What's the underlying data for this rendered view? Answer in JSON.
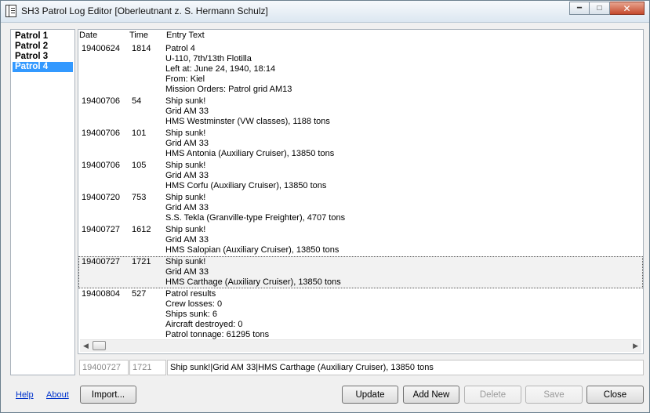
{
  "window": {
    "title": "SH3 Patrol Log Editor [Oberleutnant z. S. Hermann Schulz]"
  },
  "patrols": [
    {
      "label": "Patrol 1",
      "selected": false
    },
    {
      "label": "Patrol 2",
      "selected": false
    },
    {
      "label": "Patrol 3",
      "selected": false
    },
    {
      "label": "Patrol 4",
      "selected": true
    }
  ],
  "columns": {
    "date": "Date",
    "time": "Time",
    "text": "Entry Text"
  },
  "entries": [
    {
      "date": "19400624",
      "time": "1814",
      "lines": [
        "Patrol 4",
        "U-110, 7th/13th Flotilla",
        "Left at: June 24, 1940, 18:14",
        "From: Kiel",
        "Mission Orders: Patrol grid AM13"
      ]
    },
    {
      "date": "19400706",
      "time": "54",
      "lines": [
        "Ship sunk!",
        "Grid AM 33",
        "HMS Westminster (VW classes), 1188 tons"
      ]
    },
    {
      "date": "19400706",
      "time": "101",
      "lines": [
        "Ship sunk!",
        "Grid AM 33",
        "HMS Antonia (Auxiliary Cruiser), 13850 tons"
      ]
    },
    {
      "date": "19400706",
      "time": "105",
      "lines": [
        "Ship sunk!",
        "Grid AM 33",
        "HMS Corfu (Auxiliary Cruiser), 13850 tons"
      ]
    },
    {
      "date": "19400720",
      "time": "753",
      "lines": [
        "Ship sunk!",
        "Grid AM 33",
        "S.S. Tekla (Granville-type Freighter), 4707 tons"
      ]
    },
    {
      "date": "19400727",
      "time": "1612",
      "lines": [
        "Ship sunk!",
        "Grid AM 33",
        "HMS Salopian (Auxiliary Cruiser), 13850 tons"
      ]
    },
    {
      "date": "19400727",
      "time": "1721",
      "lines": [
        "Ship sunk!",
        "Grid AM 33",
        "HMS Carthage (Auxiliary Cruiser), 13850 tons"
      ],
      "selected": true
    },
    {
      "date": "19400804",
      "time": "527",
      "lines": [
        "Patrol results",
        "Crew losses: 0",
        "Ships sunk: 6",
        "Aircraft destroyed: 0",
        "Patrol tonnage: 61295 tons"
      ]
    }
  ],
  "editor": {
    "date": "19400727",
    "time": "1721",
    "text": "Ship sunk!|Grid AM 33|HMS Carthage (Auxiliary Cruiser), 13850 tons"
  },
  "footer": {
    "help_label": "Help",
    "about_label": "About",
    "import_label": "Import...",
    "update_label": "Update",
    "add_new_label": "Add New",
    "delete_label": "Delete",
    "save_label": "Save",
    "close_label": "Close"
  },
  "icons": {
    "app": "log-book-icon",
    "minimize": "minimize-icon",
    "maximize": "maximize-icon",
    "close": "close-icon"
  }
}
